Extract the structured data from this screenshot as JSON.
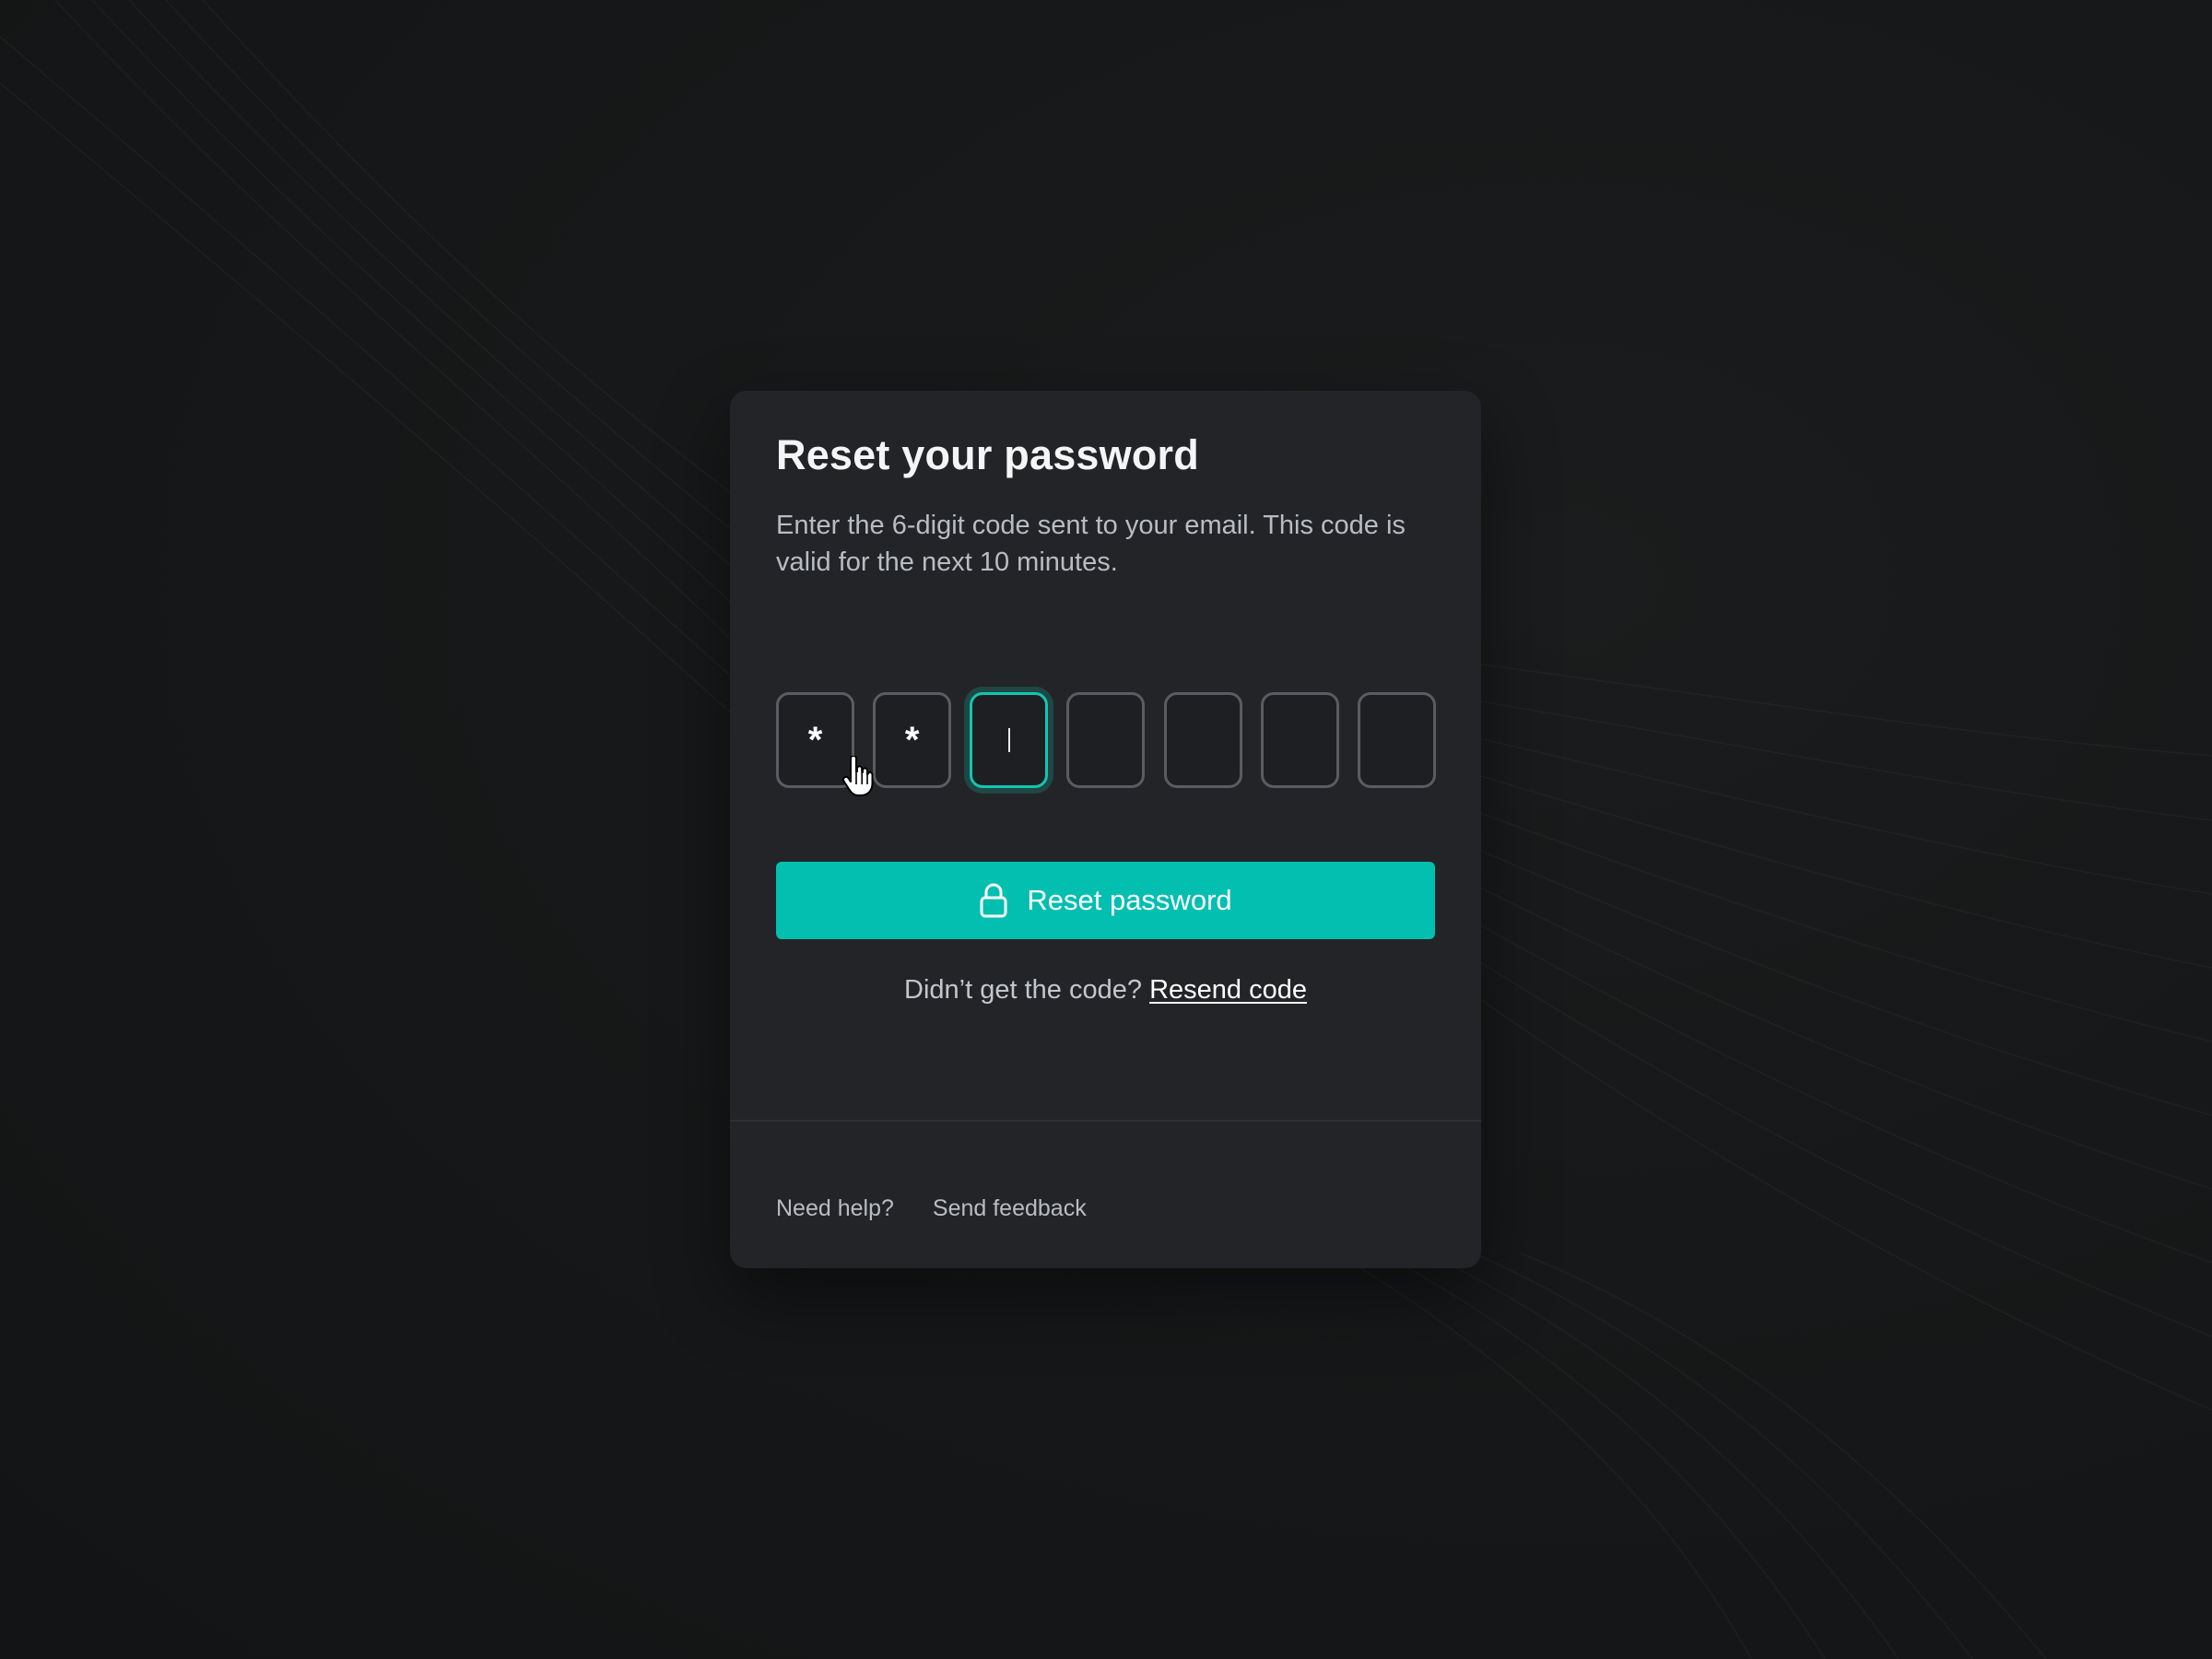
{
  "colors": {
    "page_background": "#151617",
    "card_background": "#232427",
    "accent": "#02bfb0",
    "input_border": "#5a5c61"
  },
  "reset_card": {
    "title": "Reset your password",
    "subtitle": "Enter the 6-digit code sent to your email. This code is valid for the next 10 minutes.",
    "code_inputs": [
      "*",
      "*",
      "",
      "",
      "",
      "",
      ""
    ],
    "focused_input_index": 2,
    "submit_button": {
      "label": "Reset password",
      "icon": "lock-icon"
    },
    "resend": {
      "prompt": "Didn’t get the code?",
      "link": "Resend code"
    },
    "footer": {
      "help": "Need help?",
      "feedback": "Send feedback"
    }
  },
  "pointer": {
    "icon": "hand-pointer-icon"
  }
}
